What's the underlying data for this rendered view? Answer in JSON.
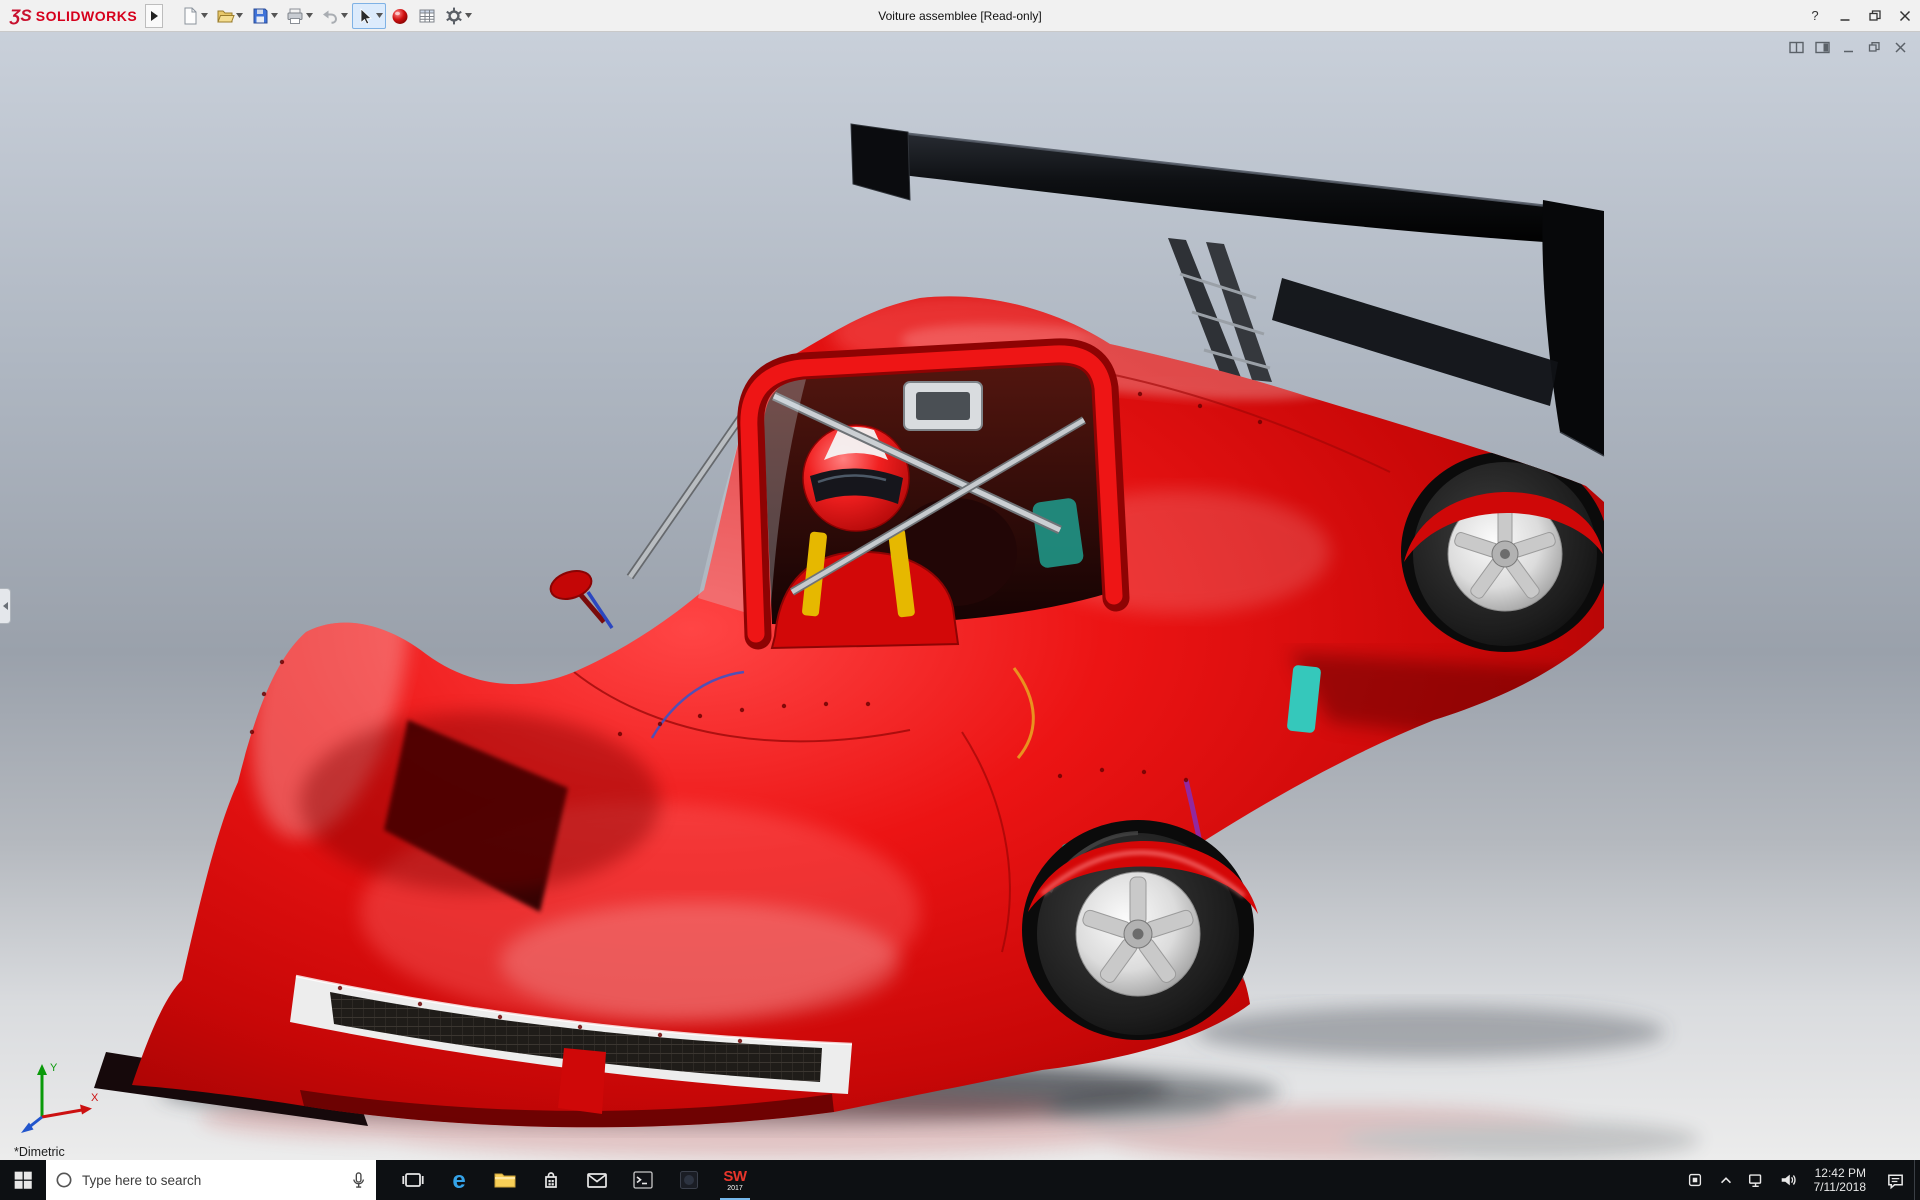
{
  "titlebar": {
    "logo_mark": "ƷS",
    "logo_text": "SOLIDWORKS",
    "title": "Voiture assemblee [Read-only]",
    "help_label": "?",
    "toolbar_items": [
      {
        "name": "new-document",
        "dropdown": true
      },
      {
        "name": "open",
        "dropdown": true
      },
      {
        "name": "save",
        "dropdown": true
      },
      {
        "name": "print",
        "dropdown": true
      },
      {
        "name": "undo",
        "dropdown": true
      },
      {
        "name": "select",
        "dropdown": true,
        "active": true
      },
      {
        "name": "edit-appearance",
        "dropdown": false
      },
      {
        "name": "design-table",
        "dropdown": false
      },
      {
        "name": "options",
        "dropdown": true
      }
    ]
  },
  "viewport": {
    "view_orientation": "*Dimetric",
    "triad": {
      "x_label": "X",
      "y_label": "Y"
    },
    "child_window_controls": [
      "split-pane",
      "pane",
      "minimize",
      "restore",
      "close"
    ]
  },
  "model": {
    "name": "Voiture assemblee",
    "body_color": "#e31010",
    "wing_color": "#0e1013",
    "driver_suit_color": "#d20808",
    "harness_color": "#e6b800",
    "accent_teal": "#35c8bb",
    "accent_purple": "#8a2bb0"
  },
  "taskbar": {
    "search_placeholder": "Type here to search",
    "edge_glyph": "e",
    "app_icons": [
      "start",
      "search",
      "task-view",
      "edge",
      "file-explorer",
      "store",
      "mail",
      "command-prompt",
      "dark-app",
      "solidworks-2017"
    ],
    "solidworks_icon_text": "SW",
    "solidworks_icon_year": "2017",
    "tray": {
      "time": "12:42 PM",
      "date": "7/11/2018",
      "icons": [
        "tray-app",
        "hidden-icons-chevron",
        "network",
        "volume",
        "clock",
        "action-center"
      ]
    }
  },
  "colors": {
    "solidworks_red": "#d6001c",
    "titlebar_bg": "#f1f1f1",
    "taskbar_bg": "#0d1013"
  }
}
